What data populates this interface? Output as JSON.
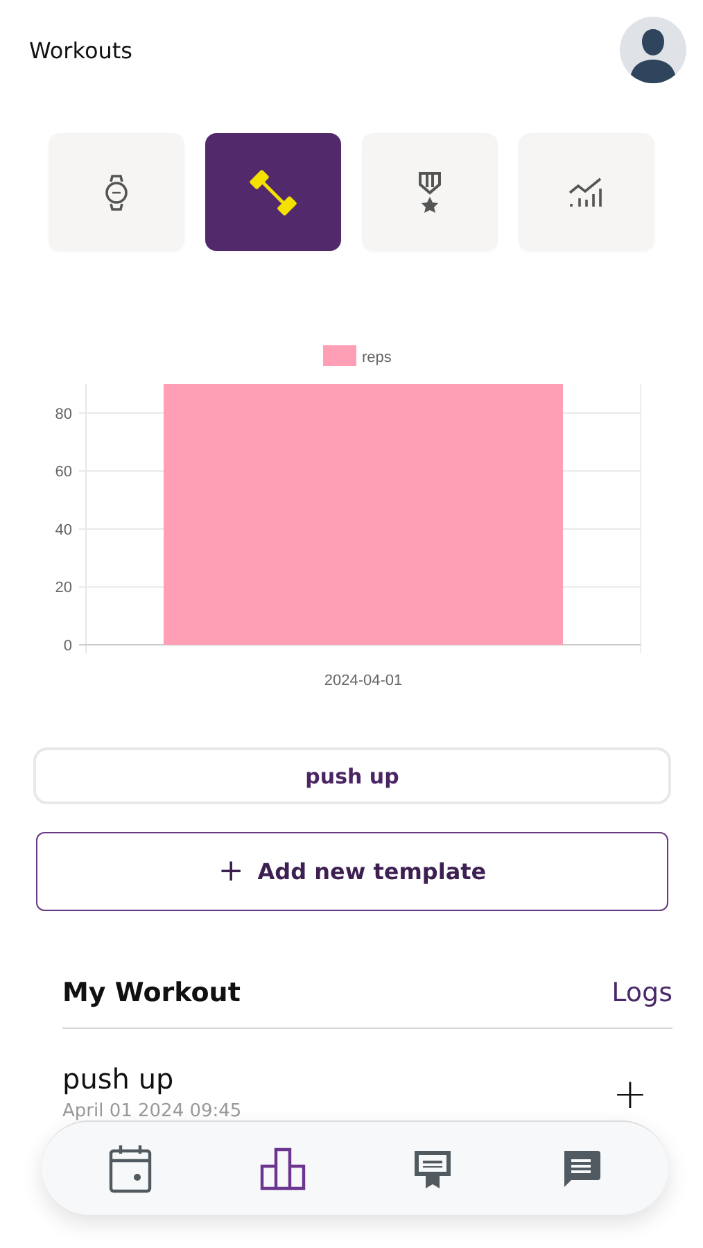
{
  "header": {
    "title": "Workouts"
  },
  "tabs": [
    {
      "kind": "watch",
      "selected": false
    },
    {
      "kind": "dumbbell",
      "selected": true
    },
    {
      "kind": "medal",
      "selected": false
    },
    {
      "kind": "chart",
      "selected": false
    }
  ],
  "chart_data": {
    "type": "bar",
    "categories": [
      "2024-04-01"
    ],
    "series": [
      {
        "name": "reps",
        "color": "#ff9fb5",
        "values": [
          90
        ]
      }
    ],
    "ylim": [
      0,
      90
    ],
    "grid": true,
    "yticks": [
      0,
      20,
      40,
      60,
      80
    ]
  },
  "exercise_select": {
    "value": "push up"
  },
  "add_button": {
    "icon": "+",
    "label": "Add new template"
  },
  "section": {
    "title": "My Workout",
    "link": "Logs"
  },
  "workouts": [
    {
      "name": "push up",
      "date": "April 01 2024 09:45",
      "action": "+"
    }
  ],
  "nav": [
    {
      "kind": "calendar",
      "selected": false
    },
    {
      "kind": "podium",
      "selected": true
    },
    {
      "kind": "certificate",
      "selected": false
    },
    {
      "kind": "message",
      "selected": false
    }
  ]
}
